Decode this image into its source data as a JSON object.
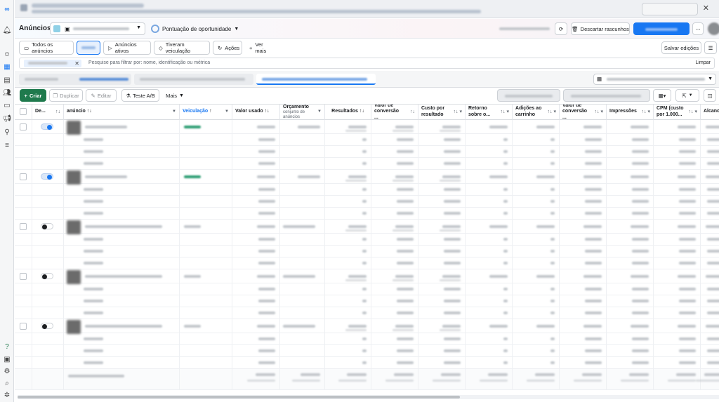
{
  "header": {
    "title": "Anúncios",
    "opportunity_label": "Pontuação de oportunidade",
    "discard_label": "Descartar rascunhos"
  },
  "tabs": {
    "all_ads": "Todos os anúncios",
    "active_ads": "Anúncios ativos",
    "had_delivery": "Tiveram veiculação",
    "actions": "Ações",
    "see_more": "Ver mais",
    "save_edits": "Salvar edições"
  },
  "search": {
    "placeholder": "Pesquise para filtrar por: nome, identificação ou métrica",
    "clear_label": "Limpar"
  },
  "toolbar": {
    "create": "Criar",
    "duplicate": "Duplicar",
    "edit": "Editar",
    "ab_test": "Teste A/B",
    "more": "Mais"
  },
  "table": {
    "headers": {
      "de": "De...",
      "ad": "anúncio",
      "delivery": "Veiculação",
      "spent": "Valor usado",
      "budget": "Orçamento",
      "budget_sub": "conjunto de anúncios",
      "results": "Resultados",
      "conv_value": "Valor de conversão ...",
      "cost_result": "Custo por resultado",
      "roas": "Retorno sobre o...",
      "add_cart": "Adições ao carrinho",
      "conv_value2": "Valor de conversão ...",
      "impressions": "Impressões",
      "cpm": "CPM (custo por 1.000...",
      "reach": "Alcance"
    },
    "rows": [
      {
        "type": "ad",
        "toggle": "on"
      },
      {
        "type": "sub"
      },
      {
        "type": "sub"
      },
      {
        "type": "sub"
      },
      {
        "type": "ad",
        "toggle": "on"
      },
      {
        "type": "sub"
      },
      {
        "type": "sub"
      },
      {
        "type": "sub"
      },
      {
        "type": "ad",
        "toggle": "off"
      },
      {
        "type": "sub"
      },
      {
        "type": "sub"
      },
      {
        "type": "sub"
      },
      {
        "type": "ad",
        "toggle": "off"
      },
      {
        "type": "sub"
      },
      {
        "type": "sub"
      },
      {
        "type": "sub"
      },
      {
        "type": "ad",
        "toggle": "off"
      },
      {
        "type": "sub"
      },
      {
        "type": "sub"
      },
      {
        "type": "sub"
      },
      {
        "type": "total"
      }
    ]
  },
  "colors": {
    "accent": "#1877f2",
    "create_green": "#1f7a4d",
    "delivery_active": "#2e9e74"
  }
}
